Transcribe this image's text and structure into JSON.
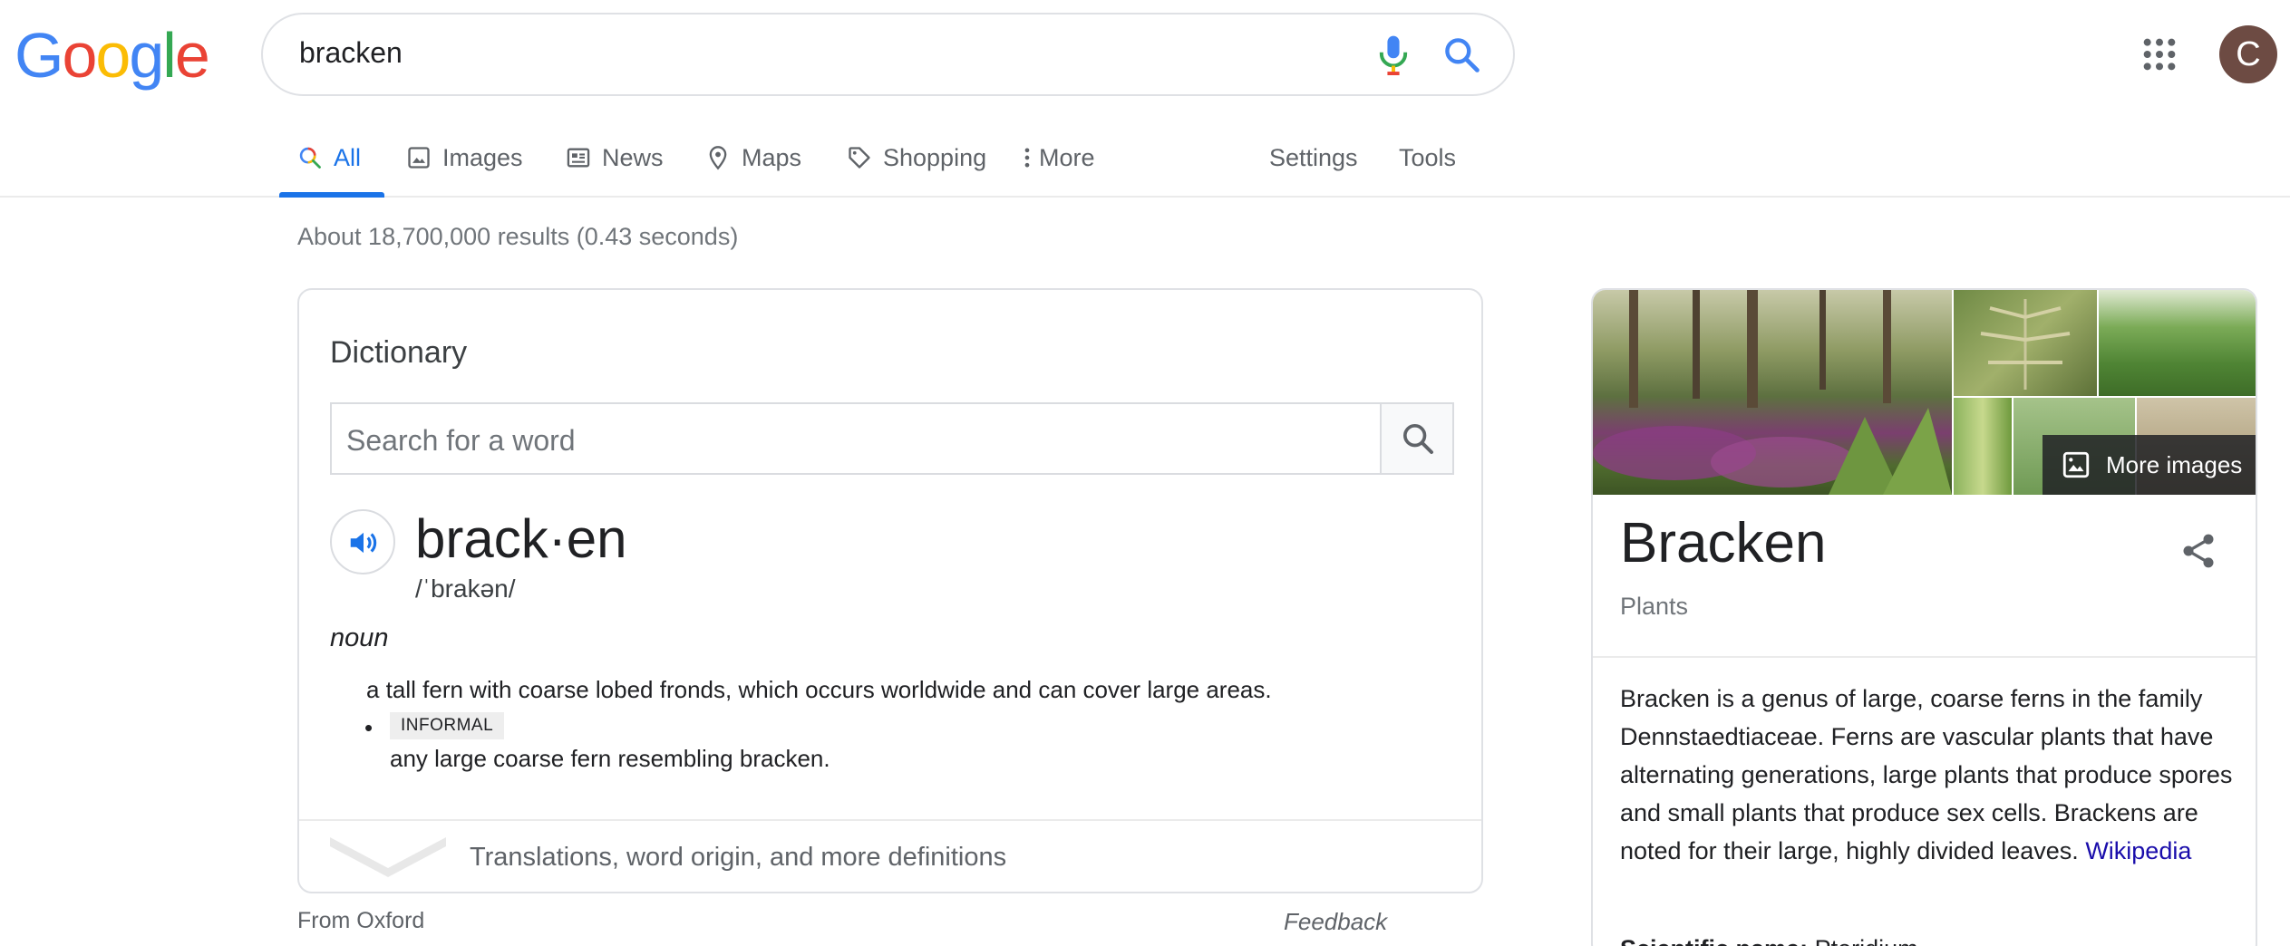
{
  "logo": {
    "text": "Google",
    "letters": [
      {
        "ch": "G",
        "color": "#4285f4"
      },
      {
        "ch": "o",
        "color": "#ea4335"
      },
      {
        "ch": "o",
        "color": "#fbbc05"
      },
      {
        "ch": "g",
        "color": "#4285f4"
      },
      {
        "ch": "l",
        "color": "#34a853"
      },
      {
        "ch": "e",
        "color": "#ea4335"
      }
    ]
  },
  "search": {
    "query": "bracken"
  },
  "user": {
    "avatar_letter": "C",
    "avatar_color": "#6d4b43"
  },
  "tabs": [
    {
      "label": "All",
      "icon": "search-icon",
      "active": true
    },
    {
      "label": "Images",
      "icon": "image-icon"
    },
    {
      "label": "News",
      "icon": "news-icon"
    },
    {
      "label": "Maps",
      "icon": "map-pin-icon"
    },
    {
      "label": "Shopping",
      "icon": "tag-icon"
    },
    {
      "label": "More",
      "icon": "more-vert-icon"
    },
    {
      "label": "Settings"
    },
    {
      "label": "Tools"
    }
  ],
  "results_stats": "About 18,700,000 results (0.43 seconds)",
  "dictionary": {
    "title": "Dictionary",
    "search_placeholder": "Search for a word",
    "headword": "brack·en",
    "phonetic": "/ˈbrakən/",
    "part_of_speech": "noun",
    "definitions": [
      {
        "text": "a tall fern with coarse lobed fronds, which occurs worldwide and can cover large areas."
      },
      {
        "label": "INFORMAL",
        "text": "any large coarse fern resembling bracken."
      }
    ],
    "more_link": "Translations, word origin, and more definitions",
    "source": "From Oxford",
    "feedback": "Feedback"
  },
  "knowledge_panel": {
    "more_images": "More images",
    "title": "Bracken",
    "subtitle": "Plants",
    "description": "Bracken is a genus of large, coarse ferns in the family Dennstaedtiaceae. Ferns are vascular plants that have alternating generations, large plants that produce spores and small plants that produce sex cells. Brackens are noted for their large, highly divided leaves.",
    "source_link": "Wikipedia",
    "sci_label": "Scientific name:",
    "sci_value": "Pteridium"
  },
  "colors": {
    "accent": "#1a73e8",
    "link": "#1a0dab"
  }
}
